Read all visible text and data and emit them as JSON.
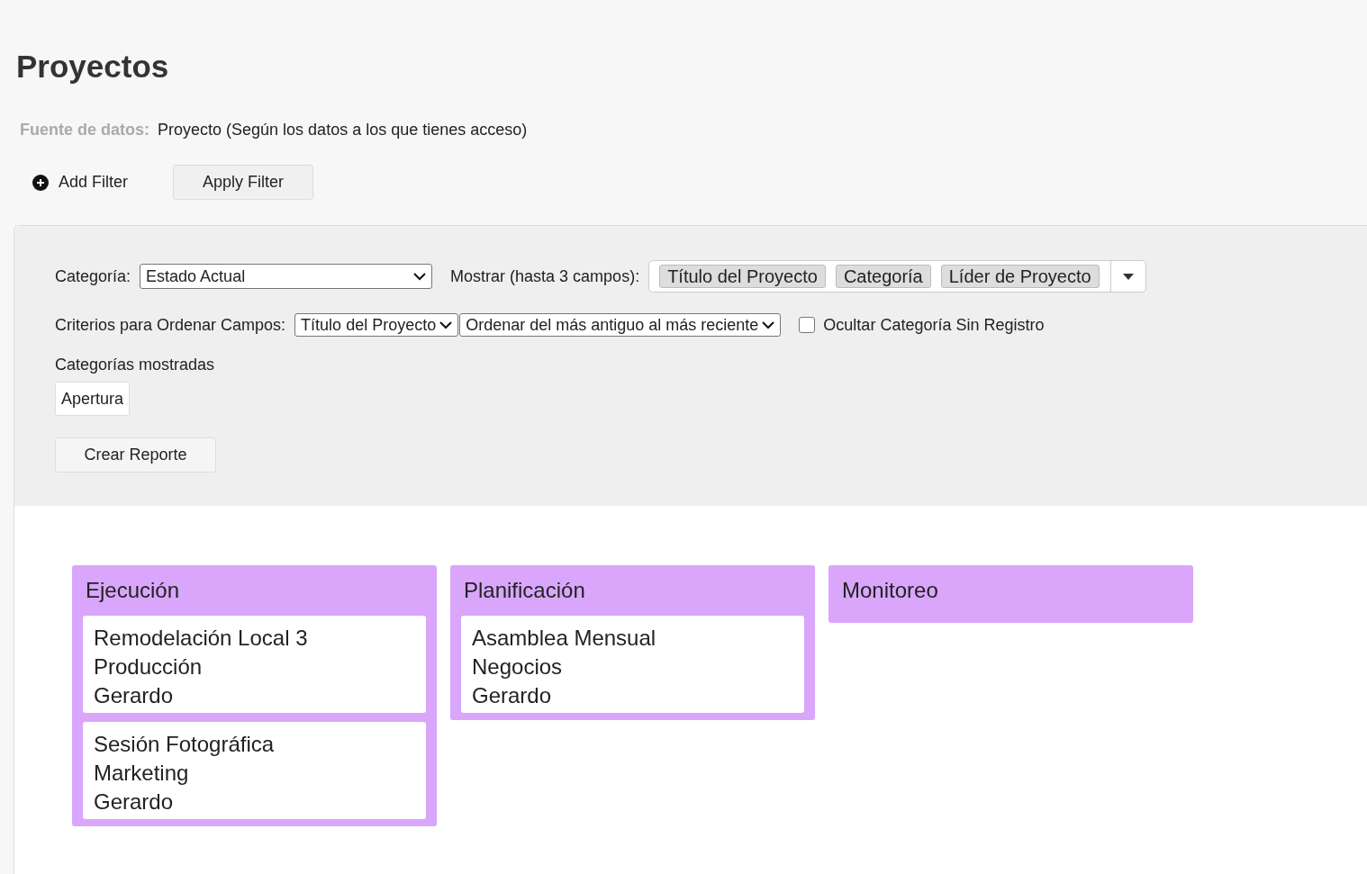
{
  "page": {
    "title": "Proyectos"
  },
  "data_source": {
    "label": "Fuente de datos:",
    "value": "Proyecto (Según los datos a los que tienes acceso)"
  },
  "filter_actions": {
    "add": "Add Filter",
    "apply": "Apply Filter"
  },
  "settings": {
    "category": {
      "label": "Categoría:",
      "value": "Estado Actual"
    },
    "show": {
      "label": "Mostrar (hasta 3 campos):",
      "tags": [
        "Título del Proyecto",
        "Categoría",
        "Líder de Proyecto"
      ]
    },
    "sort": {
      "label": "Criterios para Ordenar Campos:",
      "field": "Título del Proyecto",
      "order": "Ordenar del más antiguo al más reciente"
    },
    "hide_empty": {
      "label": "Ocultar Categoría Sin Registro",
      "checked": false
    },
    "shown_categories": {
      "label": "Categorías mostradas",
      "items": [
        "Apertura"
      ]
    },
    "create_button": "Crear Reporte"
  },
  "board": {
    "columns": [
      {
        "title": "Ejecución",
        "cards": [
          {
            "lines": [
              "Remodelación Local 3",
              "Producción",
              "Gerardo"
            ]
          },
          {
            "lines": [
              "Sesión Fotográfica",
              "Marketing",
              "Gerardo"
            ]
          }
        ]
      },
      {
        "title": "Planificación",
        "cards": [
          {
            "lines": [
              "Asamblea Mensual",
              "Negocios",
              "Gerardo"
            ]
          }
        ]
      },
      {
        "title": "Monitoreo"
      }
    ]
  }
}
